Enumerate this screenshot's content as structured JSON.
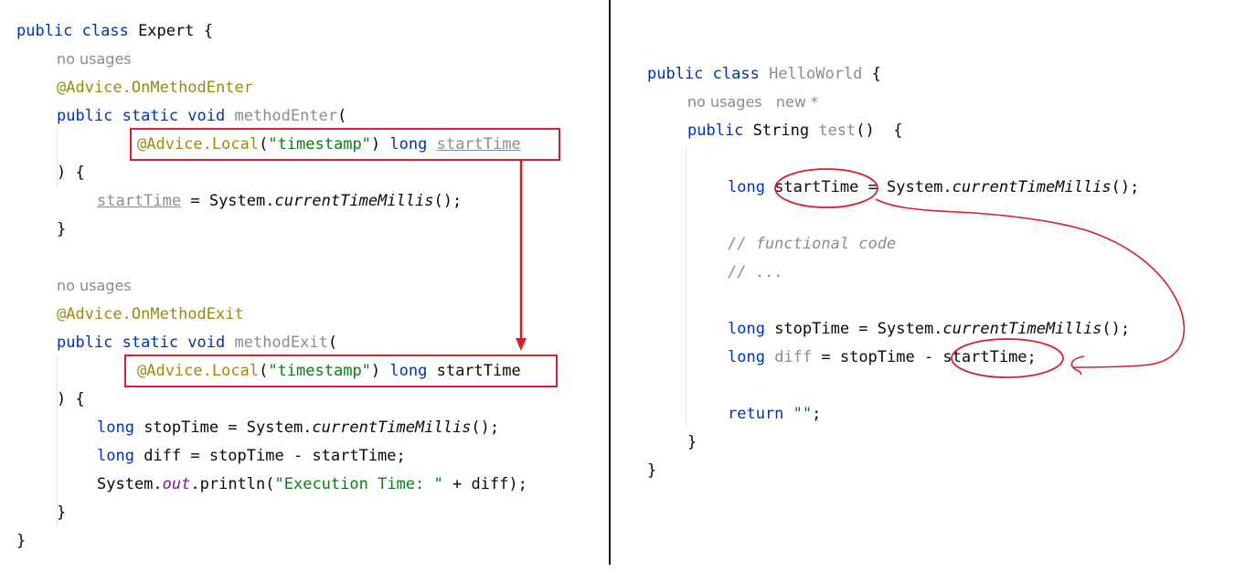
{
  "left_pane": {
    "lines": [
      {
        "id": "l_class",
        "tokens": [
          {
            "t": "public class ",
            "c": "kw"
          },
          {
            "t": "Expert {",
            "c": ""
          }
        ]
      },
      {
        "id": "l_nousage1",
        "text": "no usages"
      },
      {
        "id": "l_ann1",
        "tokens": [
          {
            "t": "@Advice.",
            "c": "ann"
          },
          {
            "t": "OnMethodEnter",
            "c": "ann"
          }
        ]
      },
      {
        "id": "l_m1",
        "tokens": [
          {
            "t": "public static void ",
            "c": "kw"
          },
          {
            "t": "methodEnter",
            "c": "gray"
          },
          {
            "t": "(",
            "c": ""
          }
        ]
      },
      {
        "id": "l_p1",
        "tokens": [
          {
            "t": "@Advice.",
            "c": "ann"
          },
          {
            "t": "Local",
            "c": "ann"
          },
          {
            "t": "(",
            "c": ""
          },
          {
            "t": "\"timestamp\"",
            "c": "str"
          },
          {
            "t": ") ",
            "c": ""
          },
          {
            "t": "long ",
            "c": "kw"
          },
          {
            "t": "startTime",
            "c": "gray ul"
          }
        ]
      },
      {
        "id": "l_close1",
        "tokens": [
          {
            "t": ") {",
            "c": ""
          }
        ]
      },
      {
        "id": "l_assign",
        "tokens": [
          {
            "t": "startTime",
            "c": "gray ul"
          },
          {
            "t": " = System.",
            "c": ""
          },
          {
            "t": "currentTimeMillis",
            "c": "ital"
          },
          {
            "t": "();",
            "c": ""
          }
        ]
      },
      {
        "id": "l_brace1",
        "tokens": [
          {
            "t": "}",
            "c": ""
          }
        ]
      },
      {
        "id": "l_nousage2",
        "text": "no usages"
      },
      {
        "id": "l_ann2",
        "tokens": [
          {
            "t": "@Advice.",
            "c": "ann"
          },
          {
            "t": "OnMethodExit",
            "c": "ann"
          }
        ]
      },
      {
        "id": "l_m2",
        "tokens": [
          {
            "t": "public static void ",
            "c": "kw"
          },
          {
            "t": "methodExit",
            "c": "gray"
          },
          {
            "t": "(",
            "c": ""
          }
        ]
      },
      {
        "id": "l_p2",
        "tokens": [
          {
            "t": "@Advice.",
            "c": "ann"
          },
          {
            "t": "Local",
            "c": "ann"
          },
          {
            "t": "(",
            "c": ""
          },
          {
            "t": "\"timestamp\"",
            "c": "str"
          },
          {
            "t": ") ",
            "c": ""
          },
          {
            "t": "long ",
            "c": "kw"
          },
          {
            "t": "startTime",
            "c": ""
          }
        ]
      },
      {
        "id": "l_close2",
        "tokens": [
          {
            "t": ") {",
            "c": ""
          }
        ]
      },
      {
        "id": "l_stop",
        "tokens": [
          {
            "t": "long ",
            "c": "kw"
          },
          {
            "t": "stopTime = System.",
            "c": ""
          },
          {
            "t": "currentTimeMillis",
            "c": "ital"
          },
          {
            "t": "();",
            "c": ""
          }
        ]
      },
      {
        "id": "l_diff",
        "tokens": [
          {
            "t": "long ",
            "c": "kw"
          },
          {
            "t": "diff = stopTime - startTime;",
            "c": ""
          }
        ]
      },
      {
        "id": "l_print",
        "tokens": [
          {
            "t": "System.",
            "c": ""
          },
          {
            "t": "out",
            "c": "purple"
          },
          {
            "t": ".println(",
            "c": ""
          },
          {
            "t": "\"Execution Time: \"",
            "c": "str"
          },
          {
            "t": " + diff);",
            "c": ""
          }
        ]
      },
      {
        "id": "l_brace2",
        "tokens": [
          {
            "t": "}",
            "c": ""
          }
        ]
      },
      {
        "id": "l_brace3",
        "tokens": [
          {
            "t": "}",
            "c": ""
          }
        ]
      }
    ]
  },
  "right_pane": {
    "lines": [
      {
        "id": "r_class",
        "tokens": [
          {
            "t": "public class ",
            "c": "kw"
          },
          {
            "t": "HelloWorld",
            "c": "gray"
          },
          {
            "t": " {",
            "c": ""
          }
        ]
      },
      {
        "id": "r_hint",
        "text": "no usages   new *"
      },
      {
        "id": "r_method",
        "tokens": [
          {
            "t": "public ",
            "c": "kw"
          },
          {
            "t": "String ",
            "c": ""
          },
          {
            "t": "test",
            "c": "gray"
          },
          {
            "t": "()  {",
            "c": ""
          }
        ]
      },
      {
        "id": "r_start",
        "tokens": [
          {
            "t": "long ",
            "c": "kw"
          },
          {
            "t": "startTime = System.",
            "c": ""
          },
          {
            "t": "currentTimeMillis",
            "c": "ital"
          },
          {
            "t": "();",
            "c": ""
          }
        ]
      },
      {
        "id": "r_cmt1",
        "tokens": [
          {
            "t": "// functional code",
            "c": "cmt"
          }
        ]
      },
      {
        "id": "r_cmt2",
        "tokens": [
          {
            "t": "// ...",
            "c": "cmt"
          }
        ]
      },
      {
        "id": "r_stop",
        "tokens": [
          {
            "t": "long ",
            "c": "kw"
          },
          {
            "t": "stopTime = System.",
            "c": ""
          },
          {
            "t": "currentTimeMillis",
            "c": "ital"
          },
          {
            "t": "();",
            "c": ""
          }
        ]
      },
      {
        "id": "r_diff",
        "tokens": [
          {
            "t": "long ",
            "c": "kw"
          },
          {
            "t": "diff",
            "c": "gray"
          },
          {
            "t": " = stopTime - startTime;",
            "c": ""
          }
        ]
      },
      {
        "id": "r_return",
        "tokens": [
          {
            "t": "return ",
            "c": "kw"
          },
          {
            "t": "\"\"",
            "c": "str"
          },
          {
            "t": ";",
            "c": ""
          }
        ]
      },
      {
        "id": "r_brace1",
        "tokens": [
          {
            "t": "}",
            "c": ""
          }
        ]
      },
      {
        "id": "r_brace2",
        "tokens": [
          {
            "t": "}",
            "c": ""
          }
        ]
      }
    ]
  },
  "colors": {
    "keyword": "#0033b3",
    "annotation": "#9e880d",
    "string": "#067d17",
    "muted": "#8c8c8c",
    "highlight_red": "#d51f2d"
  }
}
